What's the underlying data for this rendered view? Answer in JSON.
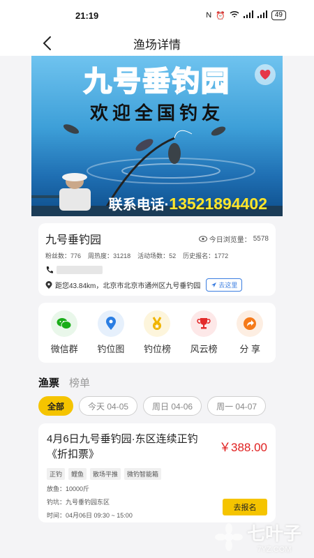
{
  "status_bar": {
    "time": "21:19",
    "battery": "49"
  },
  "navbar": {
    "title": "渔场详情"
  },
  "banner": {
    "title": "九号垂钓园",
    "welcome": "欢迎全国钓友",
    "phone_label": "联系电话·",
    "phone_number": "13521894402"
  },
  "info": {
    "name": "九号垂钓园",
    "views_label": "今日浏览量：",
    "views_value": "5578",
    "stats": [
      {
        "label": "粉丝数：",
        "value": "776"
      },
      {
        "label": "周热度：",
        "value": "31218"
      },
      {
        "label": "活动场数：",
        "value": "52"
      },
      {
        "label": "历史报名：",
        "value": "1772"
      }
    ],
    "address": "距您43.84km，北京市北京市通州区九号垂钓园",
    "goto_label": "去这里"
  },
  "actions": [
    {
      "label": "微信群",
      "icon": "wechat-icon",
      "color": "#1aad19",
      "bg": "#e9f7ea"
    },
    {
      "label": "钓位图",
      "icon": "location-pin-icon",
      "color": "#2b7ee3",
      "bg": "#e6f0fc"
    },
    {
      "label": "钓位榜",
      "icon": "medal-icon",
      "color": "#f0b400",
      "bg": "#fdf5dc"
    },
    {
      "label": "风云榜",
      "icon": "trophy-icon",
      "color": "#e32b2b",
      "bg": "#fde8e8"
    },
    {
      "label": "分 享",
      "icon": "share-icon",
      "color": "#f57a1a",
      "bg": "#fdeee2"
    }
  ],
  "tabs": [
    {
      "label": "渔票",
      "active": true
    },
    {
      "label": "榜单",
      "active": false
    }
  ],
  "date_filters": [
    {
      "label": "全部",
      "selected": true
    },
    {
      "label": "今天 04-05",
      "selected": false
    },
    {
      "label": "周日 04-06",
      "selected": false
    },
    {
      "label": "周一 04-07",
      "selected": false
    }
  ],
  "ticket": {
    "title": "4月6日九号垂钓园·东区连续正钓《折扣票》",
    "price": "￥388.00",
    "tags": [
      "正钓",
      "鲤鱼",
      "散场平推",
      "微钓智能箱"
    ],
    "fish_amount": "放鱼：10000斤",
    "spot": "钓坑：九号垂钓园东区",
    "time": "时间：04月06日 09:30 ~ 15:00",
    "signup_label": "去报名"
  },
  "watermark": {
    "text": "七叶子",
    "sub": "7YZ.COM"
  },
  "colors": {
    "accent": "#f5c400",
    "price": "#e02020",
    "link": "#3a7de0"
  }
}
